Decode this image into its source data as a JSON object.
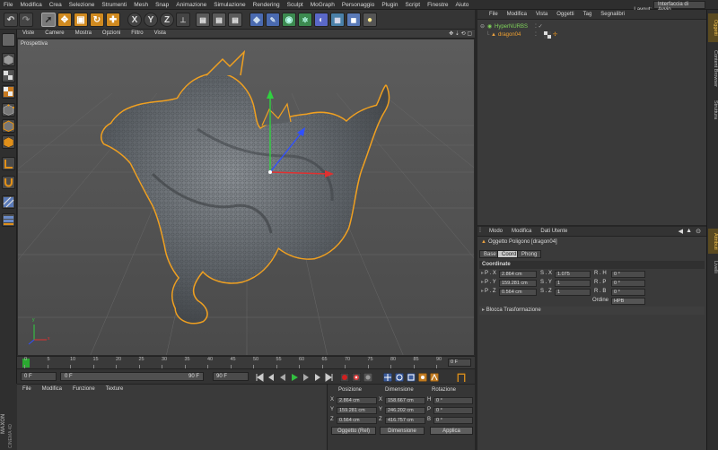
{
  "menubar": {
    "items": [
      "File",
      "Modifica",
      "Crea",
      "Selezione",
      "Strumenti",
      "Mesh",
      "Snap",
      "Animazione",
      "Simulazione",
      "Rendering",
      "Sculpt",
      "MoGraph",
      "Personaggio",
      "Plugin",
      "Script",
      "Finestre",
      "Aiuto"
    ],
    "layout_label": "Layout:",
    "layout_value": "Interfaccia di Avvio"
  },
  "toolbar": {
    "axes": [
      "X",
      "Y",
      "Z"
    ]
  },
  "viewport": {
    "menu": [
      "Viste",
      "Camere",
      "Mostra",
      "Opzioni",
      "Filtro",
      "Vista"
    ],
    "label": "Prospettiva",
    "axis_labels": [
      "y",
      "x"
    ]
  },
  "timeline": {
    "ticks": [
      "0",
      "5",
      "10",
      "15",
      "20",
      "25",
      "30",
      "35",
      "40",
      "45",
      "50",
      "55",
      "60",
      "65",
      "70",
      "75",
      "80",
      "85",
      "90"
    ],
    "end_label": "0 F"
  },
  "playbar": {
    "current_frame": "0 F",
    "range_start": "0 F",
    "range_end": "90 F",
    "max_frame": "90 F"
  },
  "material_manager": {
    "menu": [
      "File",
      "Modifica",
      "Funzione",
      "Texture"
    ],
    "logo_lines": [
      "MAXON",
      "CINEMA 4D"
    ]
  },
  "coords": {
    "headers": [
      "Posizione",
      "Dimensione",
      "Rotazione"
    ],
    "rows": [
      {
        "axis": "X",
        "pos": "2.864 cm",
        "size_axis": "X",
        "size": "158.667 cm",
        "rot_axis": "H",
        "rot": "0 °"
      },
      {
        "axis": "Y",
        "pos": "159.281 cm",
        "size_axis": "Y",
        "size": "246.202 cm",
        "rot_axis": "P",
        "rot": "0 °"
      },
      {
        "axis": "Z",
        "pos": "0.564 cm",
        "size_axis": "Z",
        "size": "416.757 cm",
        "rot_axis": "B",
        "rot": "0 °"
      }
    ],
    "mode_select": "Oggetto (Rel)",
    "size_select": "Dimensione",
    "apply_label": "Applica"
  },
  "object_manager": {
    "menu": [
      "File",
      "Modifica",
      "Vista",
      "Oggetti",
      "Tag",
      "Segnalibri"
    ],
    "objects": [
      {
        "name": "HyperNURBS",
        "color": "#7fd35a"
      },
      {
        "name": "dragon04",
        "color": "#f0a030"
      }
    ]
  },
  "attribute_manager": {
    "menu": [
      "Modo",
      "Modifica",
      "Dati Utente"
    ],
    "title": "Oggetto Poligono [dragon04]",
    "tabs": [
      "Base",
      "Coord",
      "Phong"
    ],
    "active_tab": "Coord",
    "section_coords": "Coordinate",
    "rows": [
      {
        "p_label": "P . X",
        "p": "2.864 cm",
        "s_label": "S . X",
        "s": "1.075",
        "r_label": "R . H",
        "r": "0 °"
      },
      {
        "p_label": "P . Y",
        "p": "159.281 cm",
        "s_label": "S . Y",
        "s": "1",
        "r_label": "R . P",
        "r": "0 °"
      },
      {
        "p_label": "P . Z",
        "p": "0.564 cm",
        "s_label": "S . Z",
        "s": "1",
        "r_label": "R . B",
        "r": "0 °"
      }
    ],
    "order_label": "Ordine",
    "order_value": "HPB",
    "section_freeze": "Blocca Trasformazione"
  },
  "right_tabs": {
    "top": [
      "Oggetti",
      "Content Browser",
      "Struttura"
    ],
    "bottom": [
      "Attributi",
      "Livelli"
    ]
  },
  "colors": {
    "selection_outline": "#f0a020",
    "accent_orange": "#e89420",
    "axis_x": "#e03030",
    "axis_y": "#30d040",
    "axis_z": "#3050ff"
  }
}
